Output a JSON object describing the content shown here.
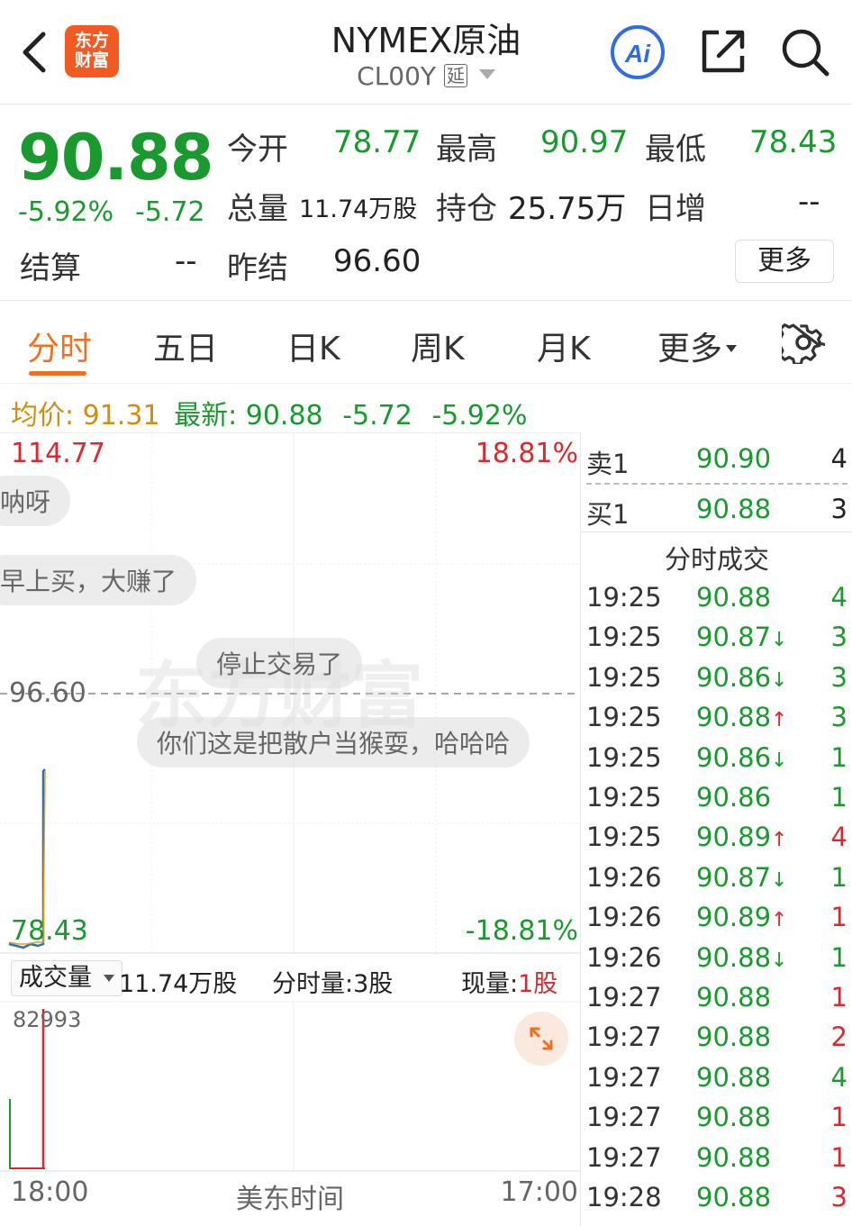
{
  "header": {
    "logo_line1": "东方",
    "logo_line2": "财富",
    "title": "NYMEX原油",
    "code": "CL00Y",
    "delay_badge": "延",
    "icons": [
      "back-icon",
      "ai-icon",
      "share-icon",
      "search-icon"
    ],
    "ai_label": "Ai"
  },
  "quote": {
    "last": "90.88",
    "pct": "-5.92%",
    "change": "-5.72",
    "open_label": "今开",
    "open": "78.77",
    "high_label": "最高",
    "high": "90.97",
    "low_label": "最低",
    "low": "78.43",
    "volume_label": "总量",
    "volume": "11.74万股",
    "oi_label": "持仓",
    "oi": "25.75万",
    "daily_inc_label": "日增",
    "daily_inc": "--",
    "settle_label": "结算",
    "settle": "--",
    "prev_settle_label": "昨结",
    "prev_settle": "96.60",
    "more_label": "更多"
  },
  "tabs": [
    {
      "label": "分时",
      "active": true
    },
    {
      "label": "五日"
    },
    {
      "label": "日K"
    },
    {
      "label": "周K"
    },
    {
      "label": "月K"
    },
    {
      "label": "更多"
    }
  ],
  "avg_bar": {
    "avg_label": "均价:",
    "avg": "91.31",
    "latest_label": "最新:",
    "latest": "90.88",
    "change": "-5.72",
    "pct": "-5.92%"
  },
  "chart": {
    "y_max": "114.77",
    "y_max_pct": "18.81%",
    "y_ref": "96.60",
    "y_min": "78.43",
    "y_min_pct": "-18.81%",
    "vol_selector": "成交量",
    "vol_total": "11.74万股",
    "vol_min_label": "分时量:3股",
    "vol_now_label": "现量:",
    "vol_now": "1股",
    "vol_max": "82993",
    "x_start": "18:00",
    "x_mid": "美东时间",
    "x_end": "17:00",
    "watermark": "东方财富",
    "bubbles": [
      "呐呀",
      "早上买，大赚了",
      "停止交易了",
      "你们这是把散户当猴耍，哈哈哈"
    ],
    "colors": {
      "price": "#3a6ea8",
      "avg": "#e0a020",
      "up": "#e0262c",
      "down": "#1a9a2e"
    }
  },
  "orderbook": {
    "ask_label": "卖1",
    "ask_price": "90.90",
    "ask_vol": "4",
    "bid_label": "买1",
    "bid_price": "90.88",
    "bid_vol": "3"
  },
  "ticks_title": "分时成交",
  "ticks": [
    {
      "time": "19:25",
      "price": "90.88",
      "dir": "",
      "vol": "4",
      "side": "down"
    },
    {
      "time": "19:25",
      "price": "90.87",
      "dir": "↓",
      "vol": "3",
      "side": "down"
    },
    {
      "time": "19:25",
      "price": "90.86",
      "dir": "↓",
      "vol": "3",
      "side": "down"
    },
    {
      "time": "19:25",
      "price": "90.88",
      "dir": "↑",
      "vol": "3",
      "side": "down"
    },
    {
      "time": "19:25",
      "price": "90.86",
      "dir": "↓",
      "vol": "1",
      "side": "down"
    },
    {
      "time": "19:25",
      "price": "90.86",
      "dir": "",
      "vol": "1",
      "side": "down"
    },
    {
      "time": "19:25",
      "price": "90.89",
      "dir": "↑",
      "vol": "4",
      "side": "up"
    },
    {
      "time": "19:26",
      "price": "90.87",
      "dir": "↓",
      "vol": "1",
      "side": "down"
    },
    {
      "time": "19:26",
      "price": "90.89",
      "dir": "↑",
      "vol": "1",
      "side": "up"
    },
    {
      "time": "19:26",
      "price": "90.88",
      "dir": "↓",
      "vol": "1",
      "side": "down"
    },
    {
      "time": "19:27",
      "price": "90.88",
      "dir": "",
      "vol": "1",
      "side": "up"
    },
    {
      "time": "19:27",
      "price": "90.88",
      "dir": "",
      "vol": "2",
      "side": "up"
    },
    {
      "time": "19:27",
      "price": "90.88",
      "dir": "",
      "vol": "4",
      "side": "down"
    },
    {
      "time": "19:27",
      "price": "90.88",
      "dir": "",
      "vol": "1",
      "side": "up"
    },
    {
      "time": "19:27",
      "price": "90.88",
      "dir": "",
      "vol": "1",
      "side": "up"
    },
    {
      "time": "19:28",
      "price": "90.88",
      "dir": "",
      "vol": "3",
      "side": "up"
    }
  ]
}
